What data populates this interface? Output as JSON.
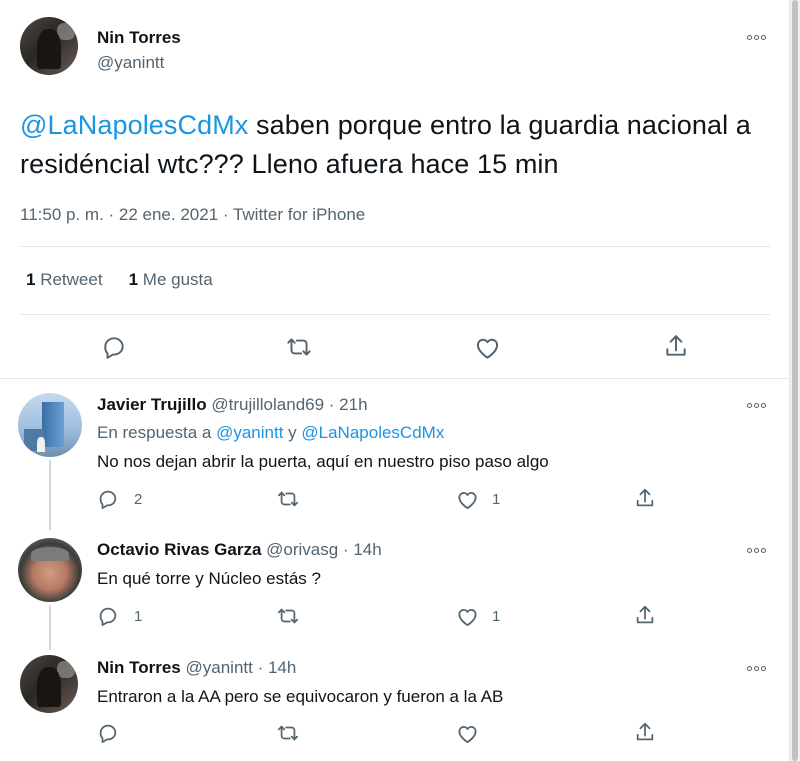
{
  "tweet": {
    "author_name": "Nin Torres",
    "author_handle": "@yanintt",
    "mention": "@LaNapolesCdMx",
    "text_rest": " saben porque entro la guardia nacional a residéncial wtc??? Lleno afuera hace 15 min",
    "meta": "11:50 p. m. · 22 ene. 2021 · Twitter for iPhone",
    "retweets_count": "1",
    "retweets_label": "Retweet",
    "likes_count": "1",
    "likes_label": "Me gusta",
    "actions": [
      "reply-icon",
      "retweet-icon",
      "like-icon",
      "share-icon"
    ]
  },
  "replies": [
    {
      "name": "Javier Trujillo",
      "handle": "@trujilloland69 · 21h",
      "reply_prefix": "En respuesta a ",
      "reply_to_1": "@yanintt",
      "reply_join": " y ",
      "reply_to_2": "@LaNapolesCdMx",
      "text": "No nos dejan abrir la puerta,  aquí en nuestro piso paso algo",
      "reply_count": "2",
      "like_count": "1"
    },
    {
      "name": "Octavio Rivas Garza",
      "handle": "@orivasg · 14h",
      "text": "En qué torre y Núcleo estás ?",
      "reply_count": "1",
      "like_count": "1"
    },
    {
      "name": "Nin Torres",
      "handle": "@yanintt · 14h",
      "text": "Entraron a la AA pero se equivocaron y fueron a la AB"
    }
  ],
  "colors": {
    "link": "#1b95e0",
    "text": "#0f1419",
    "secondary": "#536471",
    "divider": "#e1e8ed",
    "background": "#e6ecf0"
  }
}
